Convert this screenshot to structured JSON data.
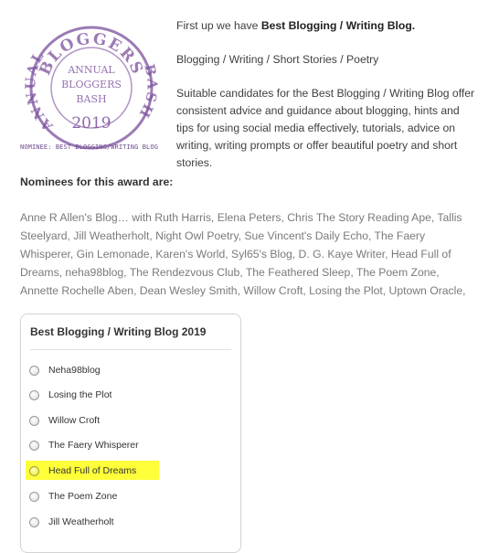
{
  "badge": {
    "arc_top": "BLOGGERS",
    "arc_left": "ANNUAL",
    "arc_right": "BASH",
    "center_line1": "ANNUAL",
    "center_line2": "BLOGGERS",
    "center_line3": "BASH",
    "year": "2019",
    "caption": "NOMINEE: BEST BLOGGING/WRITING BLOG",
    "color": "#7b4f9c"
  },
  "intro": {
    "lead_prefix": "First up we have ",
    "lead_bold": "Best Blogging / Writing Blog.",
    "categories": "Blogging / Writing / Short Stories / Poetry",
    "description": "Suitable candidates for the Best Blogging / Writing Blog offer consistent advice and guidance about blogging, hints and tips for using social media effectively, tutorials, advice on writing, writing prompts or offer beautiful poetry and short stories."
  },
  "nominees": {
    "heading": "Nominees for this award are:",
    "list": "Anne R Allen's Blog… with Ruth Harris, Elena Peters, Chris The Story Reading Ape, Tallis Steelyard, Jill Weatherholt, Night Owl Poetry, Sue Vincent's Daily Echo, The Faery Whisperer, Gin Lemonade, Karen's World, Syl65's Blog, D. G. Kaye Writer, Head Full of Dreams, neha98blog, The Rendezvous Club, The Feathered Sleep, The Poem Zone, Annette Rochelle Aben, Dean Wesley Smith, Willow Croft, Losing the Plot, Uptown Oracle,"
  },
  "poll": {
    "title": "Best Blogging / Writing Blog 2019",
    "options": [
      {
        "label": "Neha98blog"
      },
      {
        "label": "Losing the Plot"
      },
      {
        "label": "Willow Croft"
      },
      {
        "label": "The Faery Whisperer"
      },
      {
        "label": "Head Full of Dreams"
      },
      {
        "label": "The Poem Zone"
      },
      {
        "label": "Jill Weatherholt"
      }
    ],
    "highlight_color": "#ffff3a"
  }
}
